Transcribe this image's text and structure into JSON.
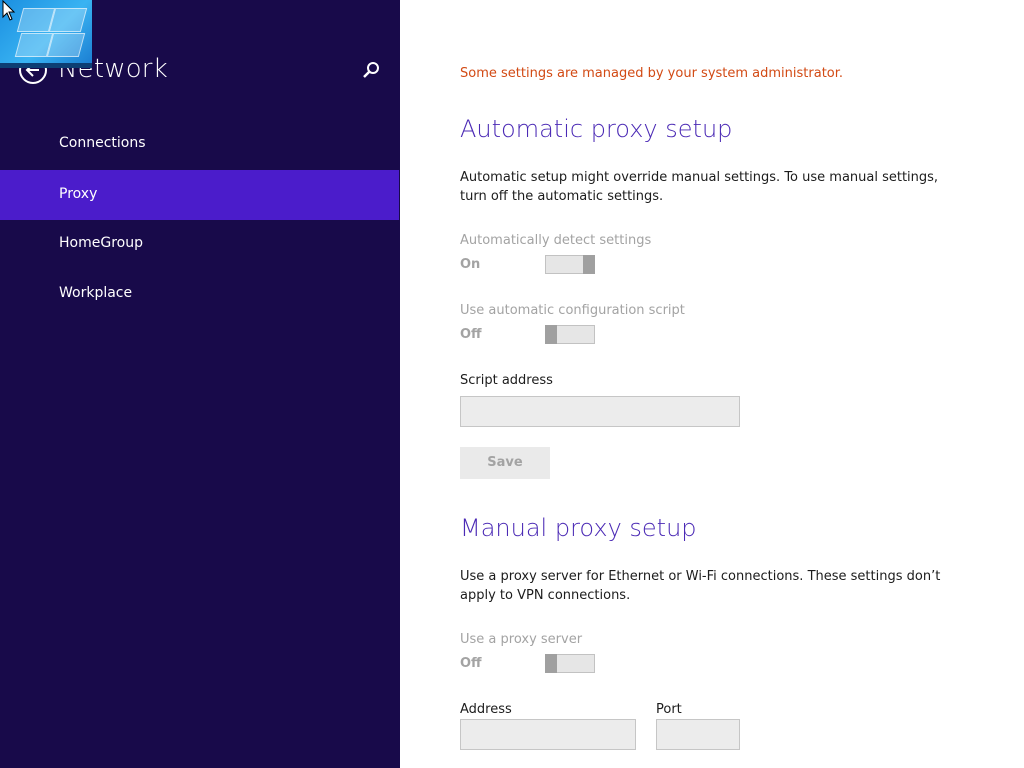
{
  "sidebar": {
    "title": "Network",
    "items": [
      {
        "label": "Connections"
      },
      {
        "label": "Proxy",
        "selected": true
      },
      {
        "label": "HomeGroup"
      },
      {
        "label": "Workplace"
      }
    ]
  },
  "main": {
    "admin_message": "Some settings are managed by your system administrator.",
    "automatic": {
      "heading": "Automatic proxy setup",
      "description": "Automatic setup might override manual settings. To use manual settings, turn off the automatic settings.",
      "detect": {
        "label": "Automatically detect settings",
        "state": "On"
      },
      "script": {
        "label": "Use automatic configuration script",
        "state": "Off"
      },
      "script_address_label": "Script address",
      "script_address_value": "",
      "save_label": "Save"
    },
    "manual": {
      "heading": "Manual proxy setup",
      "description": "Use a proxy server for Ethernet or Wi-Fi connections. These settings don’t apply to VPN connections.",
      "use_proxy": {
        "label": "Use a proxy server",
        "state": "Off"
      },
      "address_label": "Address",
      "address_value": "",
      "port_label": "Port",
      "port_value": ""
    }
  },
  "colors": {
    "sidebar_bg": "#180a4a",
    "sidebar_selected": "#4b1ccb",
    "heading": "#4b2ab5",
    "admin_warning": "#d24a14"
  },
  "icons": {
    "back": "back-arrow-icon",
    "search": "search-icon",
    "cursor": "mouse-pointer-icon"
  }
}
